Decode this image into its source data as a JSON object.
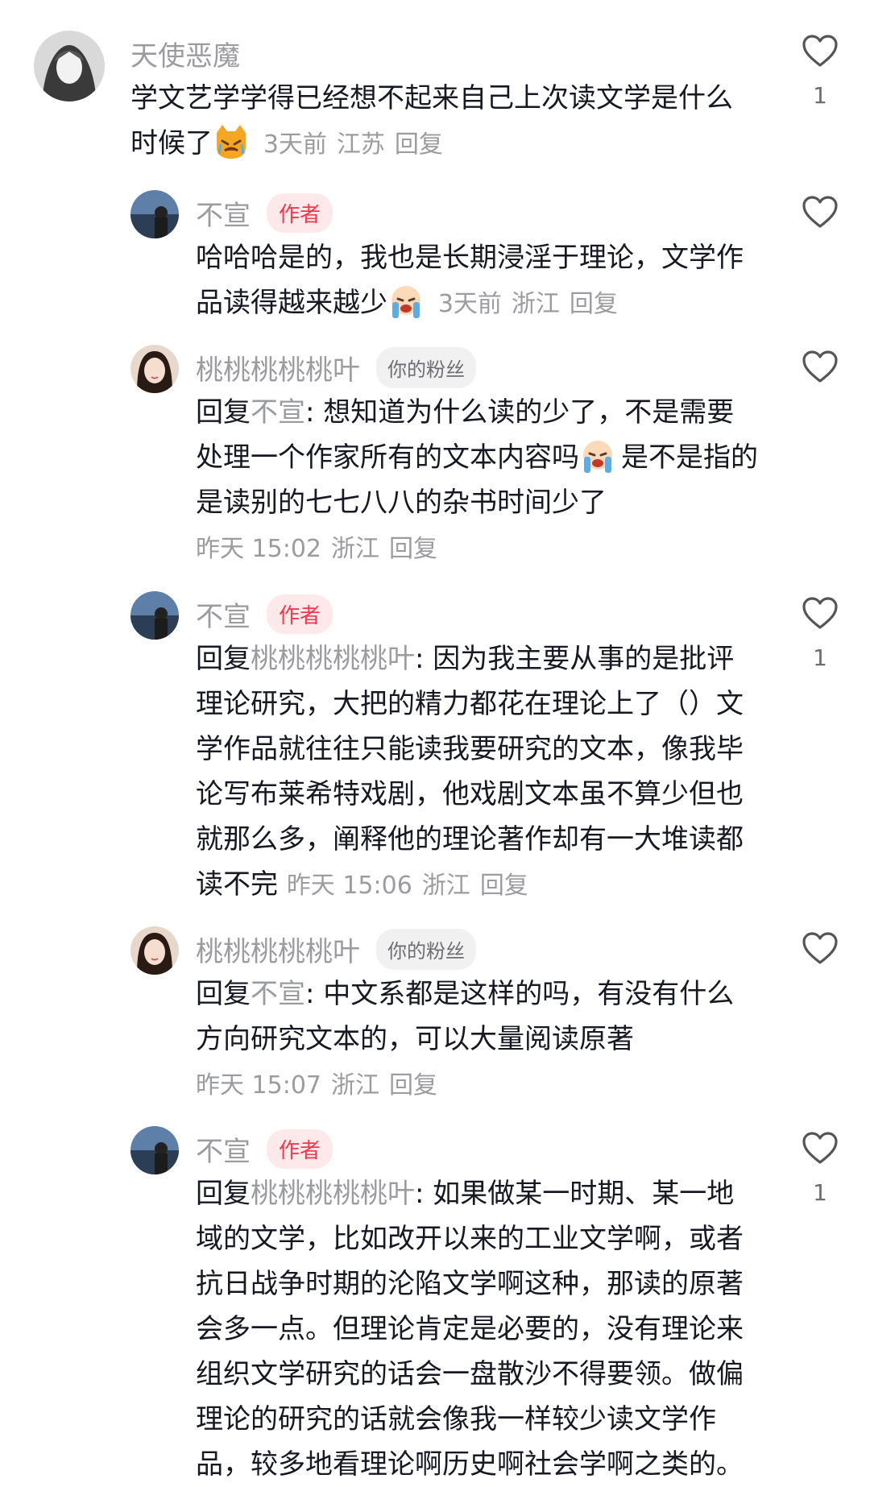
{
  "comments": [
    {
      "name": "天使恶魔",
      "text": "学文艺学学得已经想不起来自己上次读文学是什么时候了",
      "time": "3天前",
      "location": "江苏",
      "reply": "回复",
      "likes": "1"
    },
    {
      "name": "不宣",
      "badge": "作者",
      "text": "哈哈哈是的，我也是长期浸淫于理论，文学作品读得越来越少",
      "time": "3天前",
      "location": "浙江",
      "reply": "回复"
    },
    {
      "name": "桃桃桃桃桃叶",
      "badge": "你的粉丝",
      "prefix": "回复",
      "mention": "不宣",
      "text_a": ": 想知道为什么读的少了，不是需要处理一个作家所有的文本内容吗",
      "text_b": "是不是指的是读别的七七八八的杂书时间少了",
      "time": "昨天 15:02",
      "location": "浙江",
      "reply": "回复"
    },
    {
      "name": "不宣",
      "badge": "作者",
      "prefix": "回复",
      "mention": "桃桃桃桃桃叶",
      "text": ": 因为我主要从事的是批评理论研究，大把的精力都花在理论上了（）文学作品就往往只能读我要研究的文本，像我毕论写布莱希特戏剧，他戏剧文本虽不算少但也就那么多，阐释他的理论著作却有一大堆读都读不完",
      "time": "昨天 15:06",
      "location": "浙江",
      "reply": "回复",
      "likes": "1"
    },
    {
      "name": "桃桃桃桃桃叶",
      "badge": "你的粉丝",
      "prefix": "回复",
      "mention": "不宣",
      "text": ": 中文系都是这样的吗，有没有什么方向研究文本的，可以大量阅读原著",
      "time": "昨天 15:07",
      "location": "浙江",
      "reply": "回复"
    },
    {
      "name": "不宣",
      "badge": "作者",
      "prefix": "回复",
      "mention": "桃桃桃桃桃叶",
      "text": ": 如果做某一时期、某一地域的文学，比如改开以来的工业文学啊，或者抗日战争时期的沦陷文学啊这种，那读的原著会多一点。但理论肯定是必要的，没有理论来组织文学研究的话会一盘散沙不得要领。做偏理论的研究的话就会像我一样较少读文学作品，较多地看理论啊历史啊社会学啊之类的。",
      "likes": "1"
    }
  ],
  "colors": {
    "author_badge": "#f1384f",
    "meta": "#9b9ca0",
    "text": "#161823"
  },
  "icons": [
    "heart-outline-icon",
    "cat-crying-emoji",
    "baby-crying-emoji"
  ]
}
